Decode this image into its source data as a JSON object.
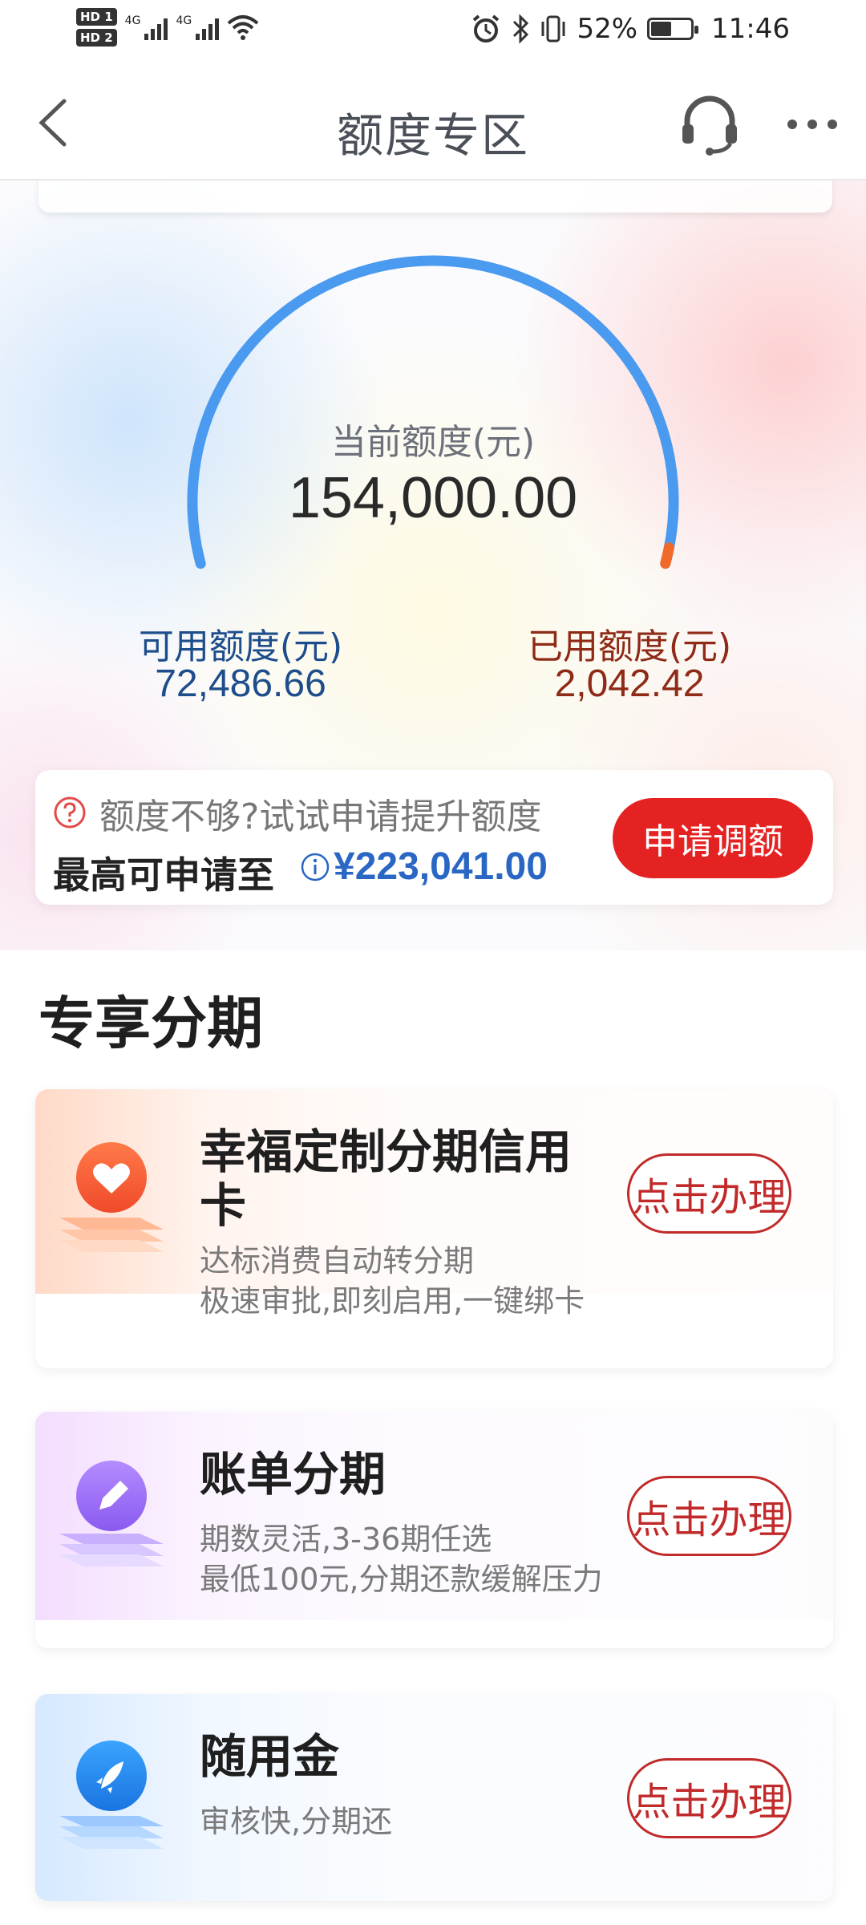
{
  "status_bar": {
    "hd1": "HD 1",
    "hd2": "HD 2",
    "net1": "4G",
    "net2": "4G",
    "battery": "52%",
    "battery_level": 0.52,
    "time": "11:46"
  },
  "nav": {
    "title": "额度专区"
  },
  "credit": {
    "current_label": "当前额度(元)",
    "current_value": "154,000.00",
    "available_label": "可用额度(元)",
    "available_value": "72,486.66",
    "used_label": "已用额度(元)",
    "used_value": "2,042.42",
    "gauge_color": "#4a9af0",
    "used_color": "#f06a2a"
  },
  "raise": {
    "hint": "额度不够?试试申请提升额度",
    "max_label": "最高可申请至",
    "max_value": "¥223,041.00",
    "apply_label": "申请调额"
  },
  "section": {
    "title": "专享分期"
  },
  "products": [
    {
      "title": "幸福定制分期信用卡",
      "desc1": "达标消费自动转分期",
      "desc2": "极速审批,即刻启用,一键绑卡",
      "button": "点击办理",
      "icon": "heart-icon",
      "accent": "#f06040"
    },
    {
      "title": "账单分期",
      "desc1": "期数灵活,3-36期任选",
      "desc2": "最低100元,分期还款缓解压力",
      "button": "点击办理",
      "icon": "pencil-icon",
      "accent": "#9b6cf0"
    },
    {
      "title": "随用金",
      "desc1": "审核快,分期还",
      "button": "点击办理",
      "icon": "rocket-icon",
      "accent": "#2a8ae8"
    }
  ]
}
